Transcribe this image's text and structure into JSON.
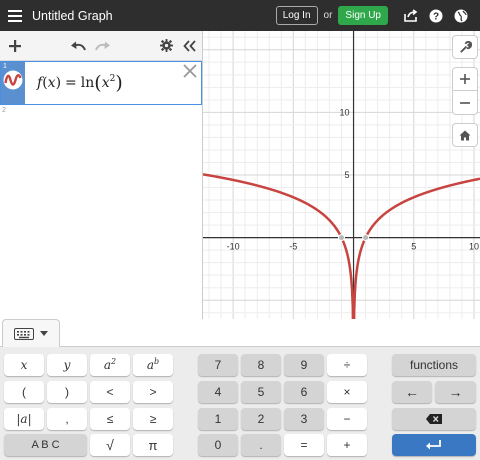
{
  "topbar": {
    "title": "Untitled Graph",
    "login_label": "Log In",
    "or_label": "or",
    "signup_label": "Sign Up",
    "accent_green": "#2ea84a"
  },
  "expressions": [
    {
      "index": "1",
      "latex_display": {
        "fname": "f",
        "arg": "x",
        "eq": "=",
        "fn": "ln",
        "base": "x",
        "power": "2"
      },
      "color": "#c74440"
    },
    {
      "index": "2"
    }
  ],
  "graph": {
    "x_ticks": [
      "-10",
      "-5",
      "5",
      "10"
    ],
    "y_ticks": [
      "5",
      "10"
    ],
    "curve_color": "#c74440",
    "function": "ln(x^2)",
    "x_range": [
      -12.5,
      10.5
    ],
    "y_range": [
      -6.5,
      16.5
    ]
  },
  "keyboard": {
    "keys": {
      "x": "x",
      "y": "y",
      "a": "a",
      "b": "b",
      "two": "2",
      "lparen": "(",
      "rparen": ")",
      "lt": "<",
      "gt": ">",
      "abs": "|a|",
      "comma": ",",
      "le": "≤",
      "ge": "≥",
      "abc": "A B C",
      "sqrt": "√",
      "pi": "π",
      "n7": "7",
      "n8": "8",
      "n9": "9",
      "div": "÷",
      "n4": "4",
      "n5": "5",
      "n6": "6",
      "mul": "×",
      "n1": "1",
      "n2": "2",
      "n3": "3",
      "minus": "−",
      "n0": "0",
      "dot": ".",
      "eq": "=",
      "plus": "+",
      "functions": "functions",
      "left": "←",
      "right": "→"
    }
  }
}
